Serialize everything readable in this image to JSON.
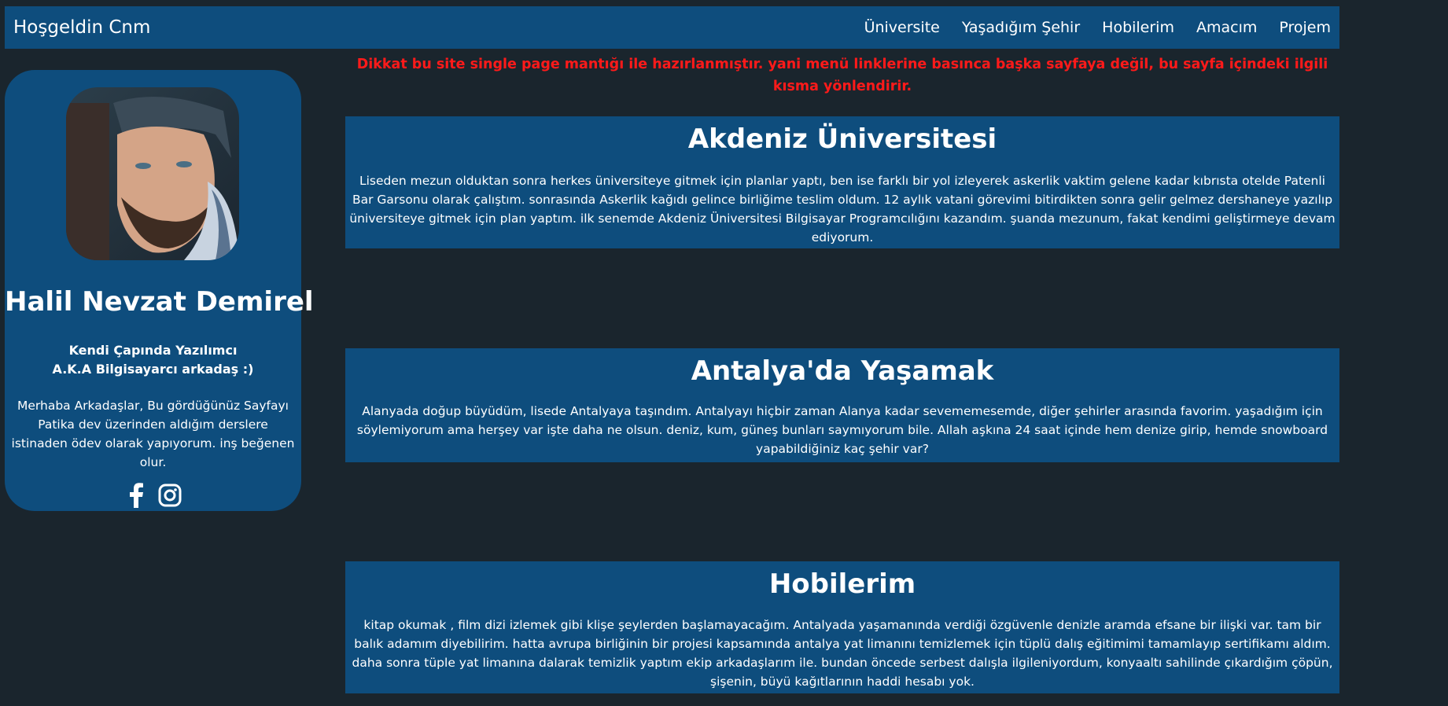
{
  "navbar": {
    "brand": "Hoşgeldin Cnm",
    "links": [
      "Üniversite",
      "Yaşadığım Şehir",
      "Hobilerim",
      "Amacım",
      "Projem"
    ]
  },
  "profile": {
    "name": "Halil Nevzat Demirel",
    "tagline_line1": "Kendi Çapında Yazılımcı",
    "tagline_line2": "A.K.A Bilgisayarcı arkadaş :)",
    "bio": "Merhaba Arkadaşlar, Bu gördüğünüz Sayfayı Patika dev üzerinden aldığım derslere istinaden ödev olarak yapıyorum. inş beğenen olur.",
    "social_icons": [
      "facebook-icon",
      "instagram-icon"
    ]
  },
  "notice": "Dikkat bu site single page mantığı ile hazırlanmıştır. yani menü linklerine basınca başka sayfaya değil, bu sayfa içindeki ilgili kısma yönlendirir.",
  "sections": [
    {
      "title": "Akdeniz Üniversitesi",
      "text": "Liseden mezun olduktan sonra herkes üniversiteye gitmek için planlar yaptı, ben ise farklı bir yol izleyerek askerlik vaktim gelene kadar kıbrısta otelde Patenli Bar Garsonu olarak çalıştım. sonrasında Askerlik kağıdı gelince birliğime teslim oldum. 12 aylık vatani görevimi bitirdikten sonra gelir gelmez dershaneye yazılıp üniversiteye gitmek için plan yaptım. ilk senemde Akdeniz Üniversitesi Bilgisayar Programcılığını kazandım. şuanda mezunum, fakat kendimi geliştirmeye devam ediyorum."
    },
    {
      "title": "Antalya'da Yaşamak",
      "text": "Alanyada doğup büyüdüm, lisede Antalyaya taşındım. Antalyayı hiçbir zaman Alanya kadar sevememesemde, diğer şehirler arasında favorim. yaşadığım için söylemiyorum ama herşey var işte daha ne olsun. deniz, kum, güneş bunları saymıyorum bile. Allah aşkına 24 saat içinde hem denize girip, hemde snowboard yapabildiğiniz kaç şehir var?"
    },
    {
      "title": "Hobilerim",
      "text": "kitap okumak , film dizi izlemek gibi klişe şeylerden başlamayacağım. Antalyada yaşamanında verdiği özgüvenle denizle aramda efsane bir ilişki var. tam bir balık adamım diyebilirim. hatta avrupa birliğinin bir projesi kapsamında antalya yat limanını temizlemek için tüplü dalış eğitimimi tamamlayıp sertifikamı aldım. daha sonra tüple yat limanına dalarak temizlik yaptım ekip arkadaşlarım ile. bundan öncede serbest dalışla ilgileniyordum, konyaaltı sahilinde çıkardığım çöpün, şişenin, büyü kağıtlarının haddi hesabı yok."
    }
  ],
  "colors": {
    "background": "#1a252d",
    "panel": "#0e4d7d",
    "notice": "#ff1a1a",
    "text": "#ffffff"
  }
}
